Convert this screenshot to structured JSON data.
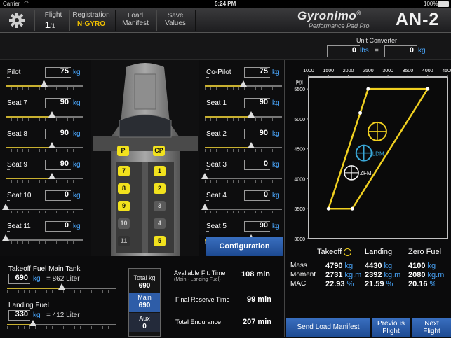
{
  "status": {
    "carrier": "Carrier",
    "time": "5:24 PM",
    "battery": "100%"
  },
  "toolbar": {
    "flight_label": "Flight",
    "flight_value": "1",
    "flight_total": "/1",
    "registration_label": "Registration",
    "registration_value": "N-GYRO",
    "load_manifest": "Load\nManifest",
    "save_values": "Save\nValues",
    "brand": "Gyronimo",
    "brand_reg": "®",
    "brand_sub": "Performance Pad Pro",
    "model": "AN-2"
  },
  "unit_converter": {
    "title": "Unit Converter",
    "lbs_value": "0",
    "lbs_unit": "lbs",
    "eq": "=",
    "kg_value": "0",
    "kg_unit": "kg"
  },
  "seats_left": [
    {
      "label": "Pilot",
      "value": "75",
      "unit": "kg",
      "level": 0.5
    },
    {
      "label": "Seat 7",
      "value": "90",
      "unit": "kg",
      "level": 0.6
    },
    {
      "label": "Seat 8",
      "value": "90",
      "unit": "kg",
      "level": 0.6
    },
    {
      "label": "Seat 9",
      "value": "90",
      "unit": "kg",
      "level": 0.6
    },
    {
      "label": "Seat 10",
      "value": "0",
      "unit": "kg",
      "level": 0.0
    },
    {
      "label": "Seat 11",
      "value": "0",
      "unit": "kg",
      "level": 0.0
    }
  ],
  "seats_right": [
    {
      "label": "Co-Pilot",
      "value": "75",
      "unit": "kg",
      "level": 0.5
    },
    {
      "label": "Seat 1",
      "value": "90",
      "unit": "kg",
      "level": 0.6
    },
    {
      "label": "Seat 2",
      "value": "90",
      "unit": "kg",
      "level": 0.6
    },
    {
      "label": "Seat 3",
      "value": "0",
      "unit": "kg",
      "level": 0.0
    },
    {
      "label": "Seat 4",
      "value": "0",
      "unit": "kg",
      "level": 0.0
    },
    {
      "label": "Seat 5",
      "value": "90",
      "unit": "kg",
      "level": 0.6
    }
  ],
  "cabin": {
    "p": "P",
    "cp": "CP",
    "left_col": [
      {
        "n": "7",
        "s": "y"
      },
      {
        "n": "8",
        "s": "y"
      },
      {
        "n": "9",
        "s": "y"
      },
      {
        "n": "10",
        "s": "g"
      },
      {
        "n": "11",
        "s": "d"
      }
    ],
    "right_col": [
      {
        "n": "1",
        "s": "y"
      },
      {
        "n": "2",
        "s": "y"
      },
      {
        "n": "3",
        "s": "g"
      },
      {
        "n": "4",
        "s": "g"
      },
      {
        "n": "5",
        "s": "y"
      }
    ]
  },
  "configuration": "Configuration",
  "fuel": {
    "main_label": "Takeoff Fuel Main Tank",
    "main_value": "690",
    "main_unit": "kg",
    "main_liter": "= 862 Liter",
    "main_level": 0.5,
    "landing_label": "Landing Fuel",
    "landing_value": "330",
    "landing_unit": "kg",
    "landing_liter": "= 412 Liter",
    "landing_level": 0.24,
    "total_label": "Total kg",
    "total_value": "690",
    "mainbox_label": "Main",
    "mainbox_value": "690",
    "aux_label": "Aux",
    "aux_value": "0"
  },
  "times": [
    {
      "label": "Avaliable Flt. Time",
      "sub": "(Main - Landing Fuel)",
      "value": "108 min"
    },
    {
      "label": "Final Reserve Time",
      "sub": "",
      "value": "99 min"
    },
    {
      "label": "Total Endurance",
      "sub": "",
      "value": "207 min"
    }
  ],
  "chart_data": {
    "type": "scatter",
    "x_ticks": [
      "1000",
      "1500",
      "2000",
      "2500",
      "3000",
      "3500",
      "4000",
      "4500"
    ],
    "y_ticks": [
      "5500",
      "5000",
      "4500",
      "4000",
      "3500",
      "3000"
    ],
    "y_unit": "[kg]",
    "xlim": [
      1000,
      4500
    ],
    "ylim": [
      3000,
      5700
    ],
    "envelope": [
      [
        1500,
        3500
      ],
      [
        2100,
        3500
      ],
      [
        4000,
        5500
      ],
      [
        2500,
        5500
      ],
      [
        2300,
        5100
      ],
      [
        1500,
        3500
      ]
    ],
    "points": [
      {
        "name": "Takeoff",
        "x": 2731,
        "y": 4790
      },
      {
        "name": "LDM",
        "x": 2392,
        "y": 4430
      },
      {
        "name": "ZFM",
        "x": 2080,
        "y": 4100
      }
    ],
    "colors": {
      "envelope": "#f0d020",
      "takeoff": "#f0d020",
      "ldm": "#3aa8d8",
      "zfm": "#ffffff"
    }
  },
  "results": {
    "headers": [
      "Takeoff",
      "Landing",
      "Zero Fuel"
    ],
    "rows": [
      {
        "label": "Mass",
        "vals": [
          [
            "4790",
            "kg"
          ],
          [
            "4430",
            "kg"
          ],
          [
            "4100",
            "kg"
          ]
        ]
      },
      {
        "label": "Moment",
        "vals": [
          [
            "2731",
            "kg.m"
          ],
          [
            "2392",
            "kg.m"
          ],
          [
            "2080",
            "kg.m"
          ]
        ]
      },
      {
        "label": "MAC",
        "vals": [
          [
            "22.93",
            "%"
          ],
          [
            "21.59",
            "%"
          ],
          [
            "20.16",
            "%"
          ]
        ]
      }
    ]
  },
  "bottom_buttons": {
    "send": "Send Load Manifest",
    "prev": "Previous\nFlight",
    "next": "Next\nFlight"
  }
}
